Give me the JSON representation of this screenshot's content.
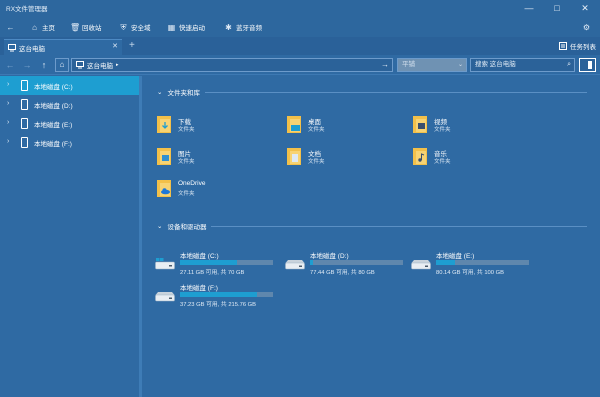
{
  "window": {
    "title": "RX文件管理器",
    "minimize_glyph": "—",
    "maximize_glyph": "□",
    "close_glyph": "✕"
  },
  "toolbar": {
    "back_glyph": "←",
    "items": [
      {
        "label": "主页",
        "icon": "home-icon",
        "glyph": "⌂"
      },
      {
        "label": "回收站",
        "icon": "recycle-bin-icon",
        "glyph": "🗑"
      },
      {
        "label": "安全域",
        "icon": "shield-icon",
        "glyph": "⛨"
      },
      {
        "label": "快速启动",
        "icon": "quick-launch-icon",
        "glyph": "▦"
      },
      {
        "label": "蓝牙音频",
        "icon": "bluetooth-icon",
        "glyph": "✱"
      }
    ],
    "settings_glyph": "⚙"
  },
  "tabs": {
    "active_label": "这台电脑",
    "close_glyph": "✕",
    "add_glyph": "+",
    "task_list_label": "任务列表"
  },
  "address": {
    "back_glyph": "←",
    "forward_glyph": "→",
    "up_glyph": "↑",
    "home_glyph": "⌂",
    "path": "这台电脑",
    "path_separator": "▸",
    "go_glyph": "→",
    "view_mode": "平铺",
    "search_placeholder": "搜索 这台电脑",
    "search_glyph": "⌕"
  },
  "sidebar": {
    "items": [
      {
        "label": "本地磁盘 (C:)",
        "selected": true
      },
      {
        "label": "本地磁盘 (D:)",
        "selected": false
      },
      {
        "label": "本地磁盘 (E:)",
        "selected": false
      },
      {
        "label": "本地磁盘 (F:)",
        "selected": false
      }
    ]
  },
  "sections": {
    "folders_title": "文件夹和库",
    "drives_title": "设备和驱动器",
    "chevron": "⌄"
  },
  "folders": [
    {
      "name": "下载",
      "type": "文件夹",
      "icon": "download-folder-icon",
      "accent": "#1e9ed1"
    },
    {
      "name": "桌面",
      "type": "文件夹",
      "icon": "desktop-folder-icon",
      "accent": "#1e9ed1"
    },
    {
      "name": "视频",
      "type": "文件夹",
      "icon": "video-folder-icon",
      "accent": "#3a4f6e"
    },
    {
      "name": "图片",
      "type": "文件夹",
      "icon": "pictures-folder-icon",
      "accent": "#2f8fd0"
    },
    {
      "name": "文档",
      "type": "文件夹",
      "icon": "documents-folder-icon",
      "accent": "#dfe9f3"
    },
    {
      "name": "音乐",
      "type": "文件夹",
      "icon": "music-folder-icon",
      "accent": "#3a4f6e"
    },
    {
      "name": "OneDrive",
      "type": "文件夹",
      "icon": "onedrive-folder-icon",
      "accent": "#1e78d7"
    }
  ],
  "drives": [
    {
      "name": "本地磁盘 (C:)",
      "free": "27.11 GB 可用, 共 70 GB",
      "used_fraction": 0.61,
      "icon": "windows-drive-icon"
    },
    {
      "name": "本地磁盘 (D:)",
      "free": "77.44 GB 可用, 共 80 GB",
      "used_fraction": 0.03,
      "icon": "drive-icon"
    },
    {
      "name": "本地磁盘 (E:)",
      "free": "80.14 GB 可用, 共 100 GB",
      "used_fraction": 0.2,
      "icon": "drive-icon"
    },
    {
      "name": "本地磁盘 (F:)",
      "free": "37.23 GB 可用, 共 215.76 GB",
      "used_fraction": 0.83,
      "icon": "drive-icon"
    }
  ],
  "colors": {
    "background": "#2f6aa3",
    "titlebar": "#2d679e",
    "accent": "#1e9ed1",
    "folder_yellow": "#f2c04a"
  }
}
